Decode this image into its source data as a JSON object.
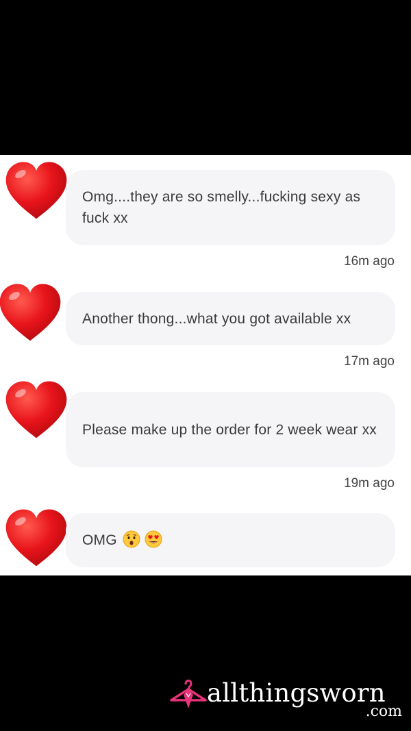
{
  "messages": [
    {
      "text": "Omg....they are so smelly...fucking sexy as fuck xx",
      "time": "16m ago"
    },
    {
      "text": "Another thong...what you got available xx",
      "time": "17m ago"
    },
    {
      "text": "Please make up the order for 2 week wear xx",
      "time": "19m ago"
    },
    {
      "text": "OMG",
      "emojis": [
        "hushed-face-emoji",
        "heart-eyes-emoji"
      ]
    }
  ],
  "avatar_icon": "red-heart-icon",
  "colors": {
    "heart": "#e8141b",
    "bubble": "#f5f5f7",
    "text": "#3a3a3c",
    "brand_pink": "#e8337a"
  },
  "logo": {
    "name": "allthingsworn",
    "tld": ".com"
  }
}
